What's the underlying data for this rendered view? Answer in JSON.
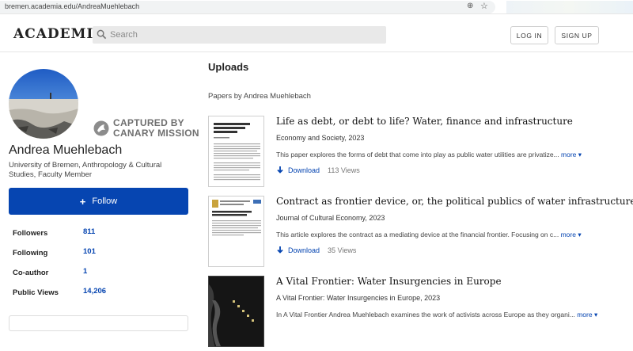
{
  "browser": {
    "url": "bremen.academia.edu/AndreaMuehlebach"
  },
  "header": {
    "logo": "ACADEMIA",
    "search_placeholder": "Search",
    "login_label": "LOG IN",
    "signup_label": "SIGN UP"
  },
  "watermark": {
    "line1": "CAPTURED BY",
    "line2": "CANARY MISSION"
  },
  "profile": {
    "name": "Andrea Muehlebach",
    "affiliation": "University of Bremen, Anthropology & Cultural Studies, Faculty Member",
    "follow_label": "Follow",
    "stats": [
      {
        "label": "Followers",
        "value": "811"
      },
      {
        "label": "Following",
        "value": "101"
      },
      {
        "label": "Co-author",
        "value": "1"
      },
      {
        "label": "Public Views",
        "value": "14,206"
      }
    ]
  },
  "main": {
    "title": "Uploads",
    "papers_heading": "Papers by Andrea Muehlebach",
    "papers": [
      {
        "title": "Life as debt, or debt to life? Water, finance and infrastructure",
        "journal": "Economy and Society, 2023",
        "abstract": "This paper explores the forms of debt that come into play as public water utilities are privatize...",
        "more_label": "more",
        "download_label": "Download",
        "views": "113 Views"
      },
      {
        "title": "Contract as frontier device, or, the political publics of water infrastructures",
        "journal": "Journal of Cultural Economy, 2023",
        "abstract": "This article explores the contract as a mediating device at the financial frontier. Focusing on c...",
        "more_label": "more",
        "download_label": "Download",
        "views": "35 Views"
      },
      {
        "title": "A Vital Frontier: Water Insurgencies in Europe",
        "journal": "A Vital Frontier: Water Insurgencies in Europe, 2023",
        "abstract": "In A Vital Frontier Andrea Muehlebach examines the work of activists across Europe as they organi...",
        "more_label": "more"
      }
    ]
  },
  "colors": {
    "accent": "#0645b1"
  }
}
